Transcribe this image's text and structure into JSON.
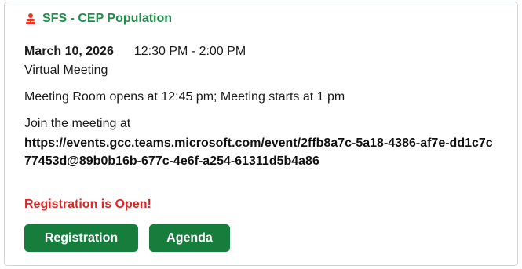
{
  "event": {
    "title": "SFS - CEP Population",
    "title_icon": "presenter-icon",
    "date": "March 10, 2026",
    "time": "12:30 PM - 2:00 PM",
    "location": "Virtual Meeting",
    "room_note": "Meeting Room opens at 12:45 pm; Meeting starts at 1 pm",
    "join_label": "Join the meeting at",
    "join_url": "https://events.gcc.teams.microsoft.com/event/2ffb8a7c-5a18-4386-af7e-dd1c7c77453d@89b0b16b-677c-4e6f-a254-61311d5b4a86",
    "registration_status": "Registration is Open!"
  },
  "actions": {
    "registration_label": "Registration",
    "agenda_label": "Agenda"
  },
  "colors": {
    "title_green": "#1e8e4a",
    "button_green": "#177d3c",
    "status_red": "#e02424",
    "icon_red": "#e03a2f"
  }
}
